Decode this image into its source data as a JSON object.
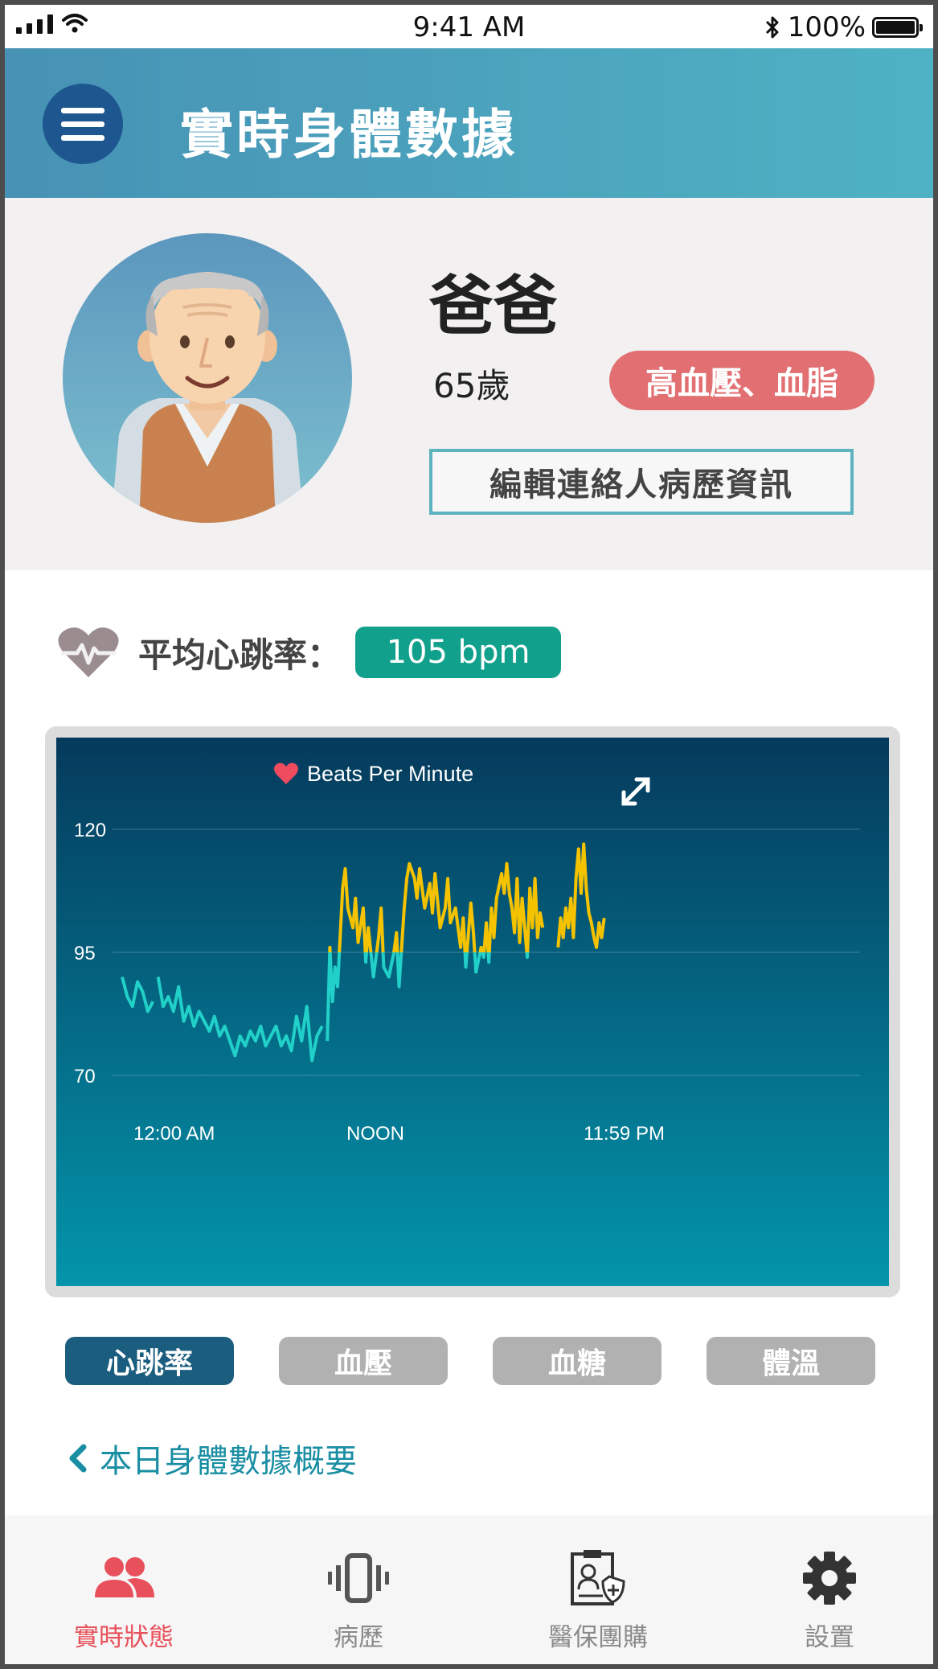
{
  "status_bar": {
    "time": "9:41 AM",
    "battery": "100%"
  },
  "header": {
    "title": "實時身體數據"
  },
  "profile": {
    "name": "爸爸",
    "age": "65歲",
    "condition_tag": "高血壓、血脂",
    "edit_button": "編輯連絡人病歷資訊"
  },
  "heart_rate": {
    "label": "平均心跳率：",
    "value": "105 bpm"
  },
  "chart_data": {
    "type": "line",
    "title": "Beats Per Minute",
    "x_tick_labels": [
      "12:00 AM",
      "NOON",
      "11:59 PM"
    ],
    "y_ticks": [
      70,
      95,
      120
    ],
    "ylim": [
      60,
      125
    ],
    "threshold": 95,
    "colors": {
      "above_threshold": "#f5c200",
      "below_threshold": "#21d0c8"
    },
    "segments": [
      [
        [
          0.0,
          90
        ],
        [
          0.01,
          86
        ],
        [
          0.02,
          84
        ],
        [
          0.03,
          89
        ],
        [
          0.04,
          87
        ],
        [
          0.05,
          83
        ],
        [
          0.06,
          85
        ]
      ],
      [
        [
          0.07,
          90
        ],
        [
          0.08,
          84
        ],
        [
          0.09,
          86
        ],
        [
          0.1,
          83
        ],
        [
          0.11,
          88
        ],
        [
          0.12,
          81
        ],
        [
          0.13,
          84
        ],
        [
          0.14,
          80
        ],
        [
          0.15,
          83
        ],
        [
          0.16,
          81
        ],
        [
          0.17,
          79
        ],
        [
          0.18,
          82
        ],
        [
          0.19,
          78
        ],
        [
          0.2,
          80
        ],
        [
          0.21,
          77
        ],
        [
          0.22,
          74
        ],
        [
          0.23,
          78
        ],
        [
          0.24,
          76
        ],
        [
          0.25,
          79
        ],
        [
          0.26,
          77
        ],
        [
          0.27,
          80
        ],
        [
          0.28,
          76
        ],
        [
          0.29,
          78
        ],
        [
          0.3,
          80
        ],
        [
          0.31,
          76
        ],
        [
          0.32,
          78
        ],
        [
          0.33,
          75
        ],
        [
          0.34,
          82
        ],
        [
          0.35,
          77
        ],
        [
          0.36,
          84
        ],
        [
          0.37,
          73
        ],
        [
          0.38,
          78
        ],
        [
          0.39,
          80
        ]
      ],
      [
        [
          0.4,
          77
        ],
        [
          0.405,
          96
        ],
        [
          0.41,
          85
        ],
        [
          0.415,
          92
        ],
        [
          0.42,
          88
        ],
        [
          0.43,
          108
        ],
        [
          0.435,
          112
        ],
        [
          0.44,
          104
        ],
        [
          0.45,
          100
        ],
        [
          0.455,
          106
        ],
        [
          0.46,
          97
        ],
        [
          0.47,
          104
        ],
        [
          0.475,
          93
        ],
        [
          0.48,
          100
        ],
        [
          0.49,
          90
        ],
        [
          0.5,
          98
        ],
        [
          0.505,
          104
        ],
        [
          0.51,
          92
        ],
        [
          0.52,
          90
        ],
        [
          0.53,
          95
        ],
        [
          0.535,
          99
        ],
        [
          0.54,
          88
        ],
        [
          0.55,
          104
        ],
        [
          0.555,
          110
        ],
        [
          0.56,
          113
        ],
        [
          0.57,
          110
        ],
        [
          0.575,
          106
        ],
        [
          0.58,
          112
        ],
        [
          0.59,
          104
        ],
        [
          0.6,
          109
        ],
        [
          0.605,
          103
        ],
        [
          0.61,
          111
        ],
        [
          0.62,
          100
        ],
        [
          0.63,
          104
        ],
        [
          0.635,
          110
        ],
        [
          0.64,
          101
        ],
        [
          0.65,
          104
        ],
        [
          0.66,
          96
        ],
        [
          0.665,
          102
        ],
        [
          0.67,
          92
        ],
        [
          0.68,
          105
        ],
        [
          0.685,
          99
        ],
        [
          0.69,
          91
        ],
        [
          0.7,
          96
        ],
        [
          0.705,
          94
        ],
        [
          0.71,
          101
        ],
        [
          0.715,
          93
        ],
        [
          0.72,
          104
        ],
        [
          0.725,
          98
        ],
        [
          0.73,
          106
        ],
        [
          0.74,
          111
        ],
        [
          0.745,
          107
        ],
        [
          0.75,
          113
        ],
        [
          0.755,
          107
        ],
        [
          0.76,
          104
        ],
        [
          0.765,
          99
        ],
        [
          0.77,
          110
        ],
        [
          0.775,
          97
        ],
        [
          0.78,
          106
        ],
        [
          0.785,
          100
        ],
        [
          0.79,
          94
        ],
        [
          0.795,
          108
        ],
        [
          0.8,
          100
        ],
        [
          0.805,
          110
        ],
        [
          0.81,
          98
        ],
        [
          0.815,
          103
        ],
        [
          0.82,
          100
        ]
      ],
      [
        [
          0.85,
          96
        ],
        [
          0.855,
          102
        ],
        [
          0.86,
          98
        ],
        [
          0.865,
          104
        ],
        [
          0.87,
          100
        ],
        [
          0.875,
          106
        ],
        [
          0.88,
          98
        ],
        [
          0.885,
          110
        ],
        [
          0.89,
          116
        ],
        [
          0.895,
          107
        ],
        [
          0.9,
          117
        ],
        [
          0.905,
          108
        ],
        [
          0.91,
          103
        ],
        [
          0.915,
          101
        ],
        [
          0.92,
          98
        ],
        [
          0.925,
          96
        ],
        [
          0.93,
          101
        ],
        [
          0.935,
          98
        ],
        [
          0.94,
          102
        ]
      ]
    ]
  },
  "metric_tabs": [
    {
      "label": "心跳率",
      "active": true
    },
    {
      "label": "血壓",
      "active": false
    },
    {
      "label": "血糖",
      "active": false
    },
    {
      "label": "體溫",
      "active": false
    }
  ],
  "summary_link": "本日身體數據概要",
  "tab_bar": [
    {
      "label": "實時狀態",
      "icon": "people-icon",
      "active": true
    },
    {
      "label": "病歷",
      "icon": "vibrating-phone-icon",
      "active": false
    },
    {
      "label": "醫保團購",
      "icon": "insurance-document-icon",
      "active": false
    },
    {
      "label": "設置",
      "icon": "gear-icon",
      "active": false
    }
  ]
}
